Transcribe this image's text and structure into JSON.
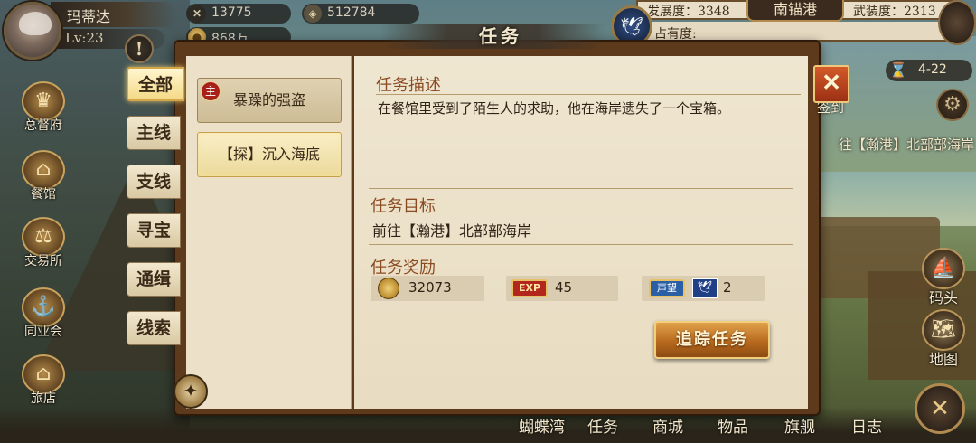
{
  "player": {
    "name": "玛蒂达",
    "level": "Lv:23"
  },
  "resources": {
    "r1": "13775",
    "r2": "512784",
    "r3": "868万"
  },
  "port": {
    "development_label": "发展度：3348",
    "name": "南锚港",
    "armament_label": "武装度：2313",
    "occupancy_label": "占有度:"
  },
  "panel": {
    "title": "任务"
  },
  "timer": "4-22",
  "sign_label": "签到",
  "right_quest": "往【瀚港】北部部海岸",
  "categories": [
    "全部",
    "主线",
    "支线",
    "寻宝",
    "通缉",
    "线索"
  ],
  "quests": [
    {
      "badge": "主",
      "label": "暴躁的强盗"
    },
    {
      "label": "【探】沉入海底"
    }
  ],
  "detail": {
    "desc_title": "任务描述",
    "desc": "在餐馆里受到了陌生人的求助，他在海岸遗失了一个宝箱。",
    "target_title": "任务目标",
    "target": "前往【瀚港】北部部海岸",
    "reward_title": "任务奖励",
    "rewards": {
      "gold": "32073",
      "exp_badge": "EXP",
      "exp": "45",
      "rep_badge": "声望",
      "rep": "2"
    },
    "track_button": "追踪任务"
  },
  "left_menu": [
    "总督府",
    "餐馆",
    "交易所",
    "同业会",
    "旅店"
  ],
  "right_menu": [
    "码头",
    "地图"
  ],
  "bottom_nav": [
    "蝴蝶湾",
    "任务",
    "商城",
    "物品",
    "旗舰",
    "日志"
  ],
  "colors": {
    "accent": "#8a4b22",
    "track_button": "#b76a1e",
    "close": "#c4461f"
  }
}
